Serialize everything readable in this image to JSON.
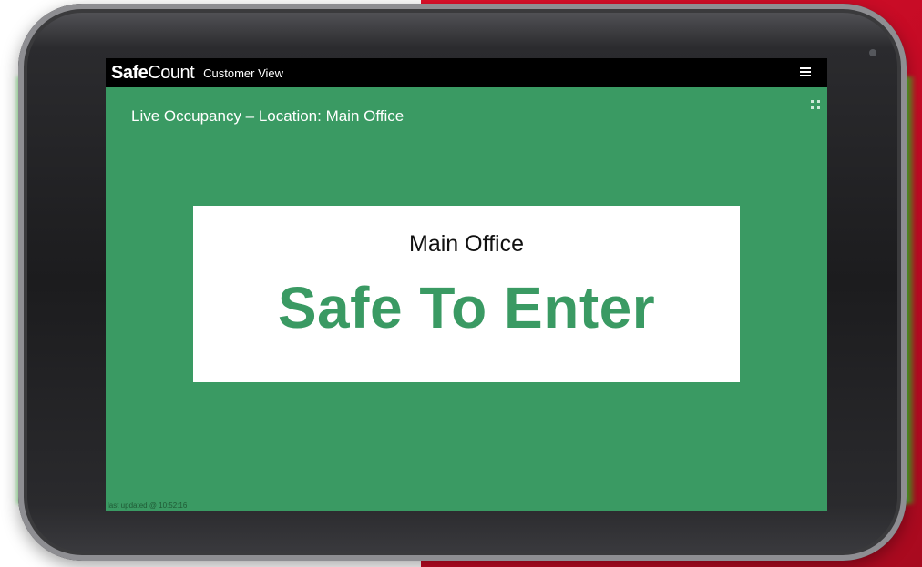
{
  "app": {
    "brand_part1": "Safe",
    "brand_part2": "Count",
    "view_label": "Customer View"
  },
  "header": {
    "live_label": "Live Occupancy – Location: Main Office"
  },
  "status_card": {
    "location": "Main Office",
    "status": "Safe To Enter"
  },
  "footer": {
    "updated_text": "last updated @ 10:52:16"
  },
  "icons": {
    "menu": "hamburger-menu-icon",
    "fullscreen": "fullscreen-icon"
  },
  "colors": {
    "screen_bg": "#3a9a63",
    "status_text": "#3a9a63",
    "glow": "#28e628",
    "brand_red": "#e0112b"
  }
}
